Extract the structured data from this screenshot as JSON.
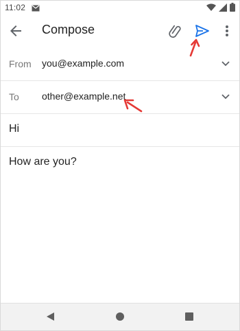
{
  "status_bar": {
    "time": "11:02",
    "mail_icon": "mail-icon",
    "wifi_icon": "wifi-icon",
    "signal_icon": "signal-icon",
    "battery_icon": "battery-icon"
  },
  "toolbar": {
    "back_icon": "arrow-back-icon",
    "title": "Compose",
    "attach_icon": "paperclip-icon",
    "send_icon": "send-icon",
    "more_icon": "more-vert-icon"
  },
  "from": {
    "label": "From",
    "value": "you@example.com"
  },
  "to": {
    "label": "To",
    "value": "other@example.net"
  },
  "subject": {
    "value": "Hi"
  },
  "body": {
    "value": "How are you?"
  },
  "nav_bar": {
    "back_icon": "nav-back-icon",
    "home_icon": "nav-home-icon",
    "recents_icon": "nav-recents-icon"
  },
  "colors": {
    "accent": "#1a73e8",
    "annotation": "#e53935",
    "divider": "#e6e6e6",
    "icon": "#5f6368"
  }
}
